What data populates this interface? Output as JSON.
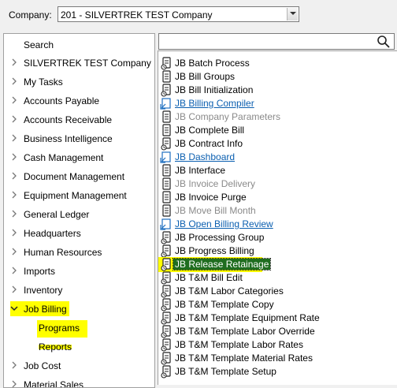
{
  "company": {
    "label": "Company:",
    "selected": "201 - SILVERTREK TEST Company"
  },
  "nav": {
    "search_label": "Search",
    "items": [
      {
        "label": "SILVERTREK TEST Company",
        "expanded": false
      },
      {
        "label": "My Tasks",
        "expanded": false
      },
      {
        "label": "Accounts Payable",
        "expanded": false
      },
      {
        "label": "Accounts Receivable",
        "expanded": false
      },
      {
        "label": "Business Intelligence",
        "expanded": false
      },
      {
        "label": "Cash Management",
        "expanded": false
      },
      {
        "label": "Document Management",
        "expanded": false
      },
      {
        "label": "Equipment Management",
        "expanded": false
      },
      {
        "label": "General Ledger",
        "expanded": false
      },
      {
        "label": "Headquarters",
        "expanded": false
      },
      {
        "label": "Human Resources",
        "expanded": false
      },
      {
        "label": "Imports",
        "expanded": false
      },
      {
        "label": "Inventory",
        "expanded": false
      },
      {
        "label": "Job Billing",
        "expanded": true,
        "highlighted": true
      },
      {
        "label": "Programs",
        "child": true,
        "highlighted": true
      },
      {
        "label": "Reports",
        "child": true
      },
      {
        "label": "Job Cost",
        "expanded": false
      },
      {
        "label": "Material Sales",
        "expanded": false
      }
    ]
  },
  "search": {
    "value": "",
    "placeholder": ""
  },
  "programs": [
    {
      "label": "JB Batch Process",
      "state": "normal",
      "icon": "batch-form-icon"
    },
    {
      "label": "JB Bill Groups",
      "state": "normal",
      "icon": "form-icon"
    },
    {
      "label": "JB Bill Initialization",
      "state": "normal",
      "icon": "batch-form-icon"
    },
    {
      "label": "JB Billing Compiler",
      "state": "link",
      "icon": "launch-link-icon"
    },
    {
      "label": "JB Company Parameters",
      "state": "disabled",
      "icon": "form-icon"
    },
    {
      "label": "JB Complete Bill",
      "state": "normal",
      "icon": "form-icon"
    },
    {
      "label": "JB Contract Info",
      "state": "normal",
      "icon": "batch-form-icon"
    },
    {
      "label": "JB Dashboard",
      "state": "link",
      "icon": "launch-link-icon"
    },
    {
      "label": "JB Interface",
      "state": "normal",
      "icon": "form-icon"
    },
    {
      "label": "JB Invoice Delivery",
      "state": "disabled",
      "icon": "form-icon"
    },
    {
      "label": "JB Invoice Purge",
      "state": "normal",
      "icon": "form-icon"
    },
    {
      "label": "JB Move Bill Month",
      "state": "disabled",
      "icon": "form-icon"
    },
    {
      "label": "JB Open Billing Review",
      "state": "link",
      "icon": "launch-link-icon"
    },
    {
      "label": "JB Processing Group",
      "state": "normal",
      "icon": "batch-form-icon"
    },
    {
      "label": "JB Progress Billing",
      "state": "normal",
      "icon": "batch-form-icon"
    },
    {
      "label": "JB Release Retainage",
      "state": "selected",
      "icon": "batch-form-icon"
    },
    {
      "label": "JB T&M Bill Edit",
      "state": "normal",
      "icon": "batch-form-icon"
    },
    {
      "label": "JB T&M Labor Categories",
      "state": "normal",
      "icon": "batch-form-icon"
    },
    {
      "label": "JB T&M Template Copy",
      "state": "normal",
      "icon": "batch-form-icon"
    },
    {
      "label": "JB T&M Template Equipment Rate",
      "state": "normal",
      "icon": "batch-form-icon"
    },
    {
      "label": "JB T&M Template Labor Override",
      "state": "normal",
      "icon": "batch-form-icon"
    },
    {
      "label": "JB T&M Template Labor Rates",
      "state": "normal",
      "icon": "batch-form-icon"
    },
    {
      "label": "JB T&M Template Material Rates",
      "state": "normal",
      "icon": "batch-form-icon"
    },
    {
      "label": "JB T&M Template Setup",
      "state": "normal",
      "icon": "batch-form-icon"
    }
  ],
  "colors": {
    "highlight": "#ffff00",
    "selected_bg": "#1f6d1f",
    "link": "#0b5fb0",
    "disabled": "#8a8a8a"
  }
}
